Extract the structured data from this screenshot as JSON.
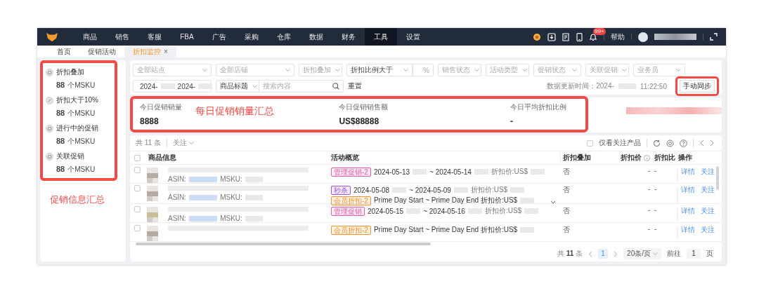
{
  "nav": {
    "items": [
      {
        "label": "商品",
        "selected": false
      },
      {
        "label": "销售",
        "selected": false
      },
      {
        "label": "客服",
        "selected": false
      },
      {
        "label": "FBA",
        "selected": false
      },
      {
        "label": "广告",
        "selected": false
      },
      {
        "label": "采购",
        "selected": false
      },
      {
        "label": "仓库",
        "selected": false
      },
      {
        "label": "数据",
        "selected": false
      },
      {
        "label": "财务",
        "selected": false
      },
      {
        "label": "工具",
        "selected": true
      },
      {
        "label": "设置",
        "selected": false
      }
    ],
    "badge": "99+",
    "help": "帮助"
  },
  "tabs": [
    {
      "label": "首页",
      "selected": false
    },
    {
      "label": "促销活动",
      "selected": false
    },
    {
      "label": "折扣监控",
      "selected": true,
      "close": "×"
    }
  ],
  "summary": [
    {
      "label": "折扣叠加",
      "count": "88",
      "unit": "个MSKU"
    },
    {
      "label": "折扣大于10%",
      "count": "88",
      "unit": "个MSKU"
    },
    {
      "label": "进行中的促销",
      "count": "88",
      "unit": "个MSKU"
    },
    {
      "label": "关联促销",
      "count": "88",
      "unit": "个MSKU"
    }
  ],
  "annotations": {
    "summary": "促销信息汇总",
    "stats": "每日促销销量汇总"
  },
  "filters": [
    {
      "kind": "select",
      "placeholder": "全部站点"
    },
    {
      "kind": "select",
      "placeholder": "全部店铺"
    },
    {
      "kind": "select",
      "placeholder": "折扣叠加"
    },
    {
      "kind": "select",
      "value": "折扣比例大于"
    },
    {
      "kind": "unit",
      "unit": "%"
    },
    {
      "kind": "select",
      "placeholder": "销售状态"
    },
    {
      "kind": "select",
      "placeholder": "活动类型"
    },
    {
      "kind": "select",
      "placeholder": "促销状态"
    },
    {
      "kind": "select",
      "placeholder": "关联促销"
    },
    {
      "kind": "select",
      "placeholder": "业务员"
    }
  ],
  "search": {
    "date_start": "2024-",
    "date_end": "2024-",
    "field": "商品标题",
    "placeholder": "搜索内容",
    "reset": "重置"
  },
  "update": {
    "label": "数据更新时间：2024-",
    "time": "11:22:50"
  },
  "sync_button": "手动同步",
  "stats": [
    {
      "label": "今日促销销量",
      "value": "8888"
    },
    {
      "label": "今日促销销售额",
      "value": "US$88888"
    },
    {
      "label": "今日平均折扣比例",
      "value": "-"
    }
  ],
  "toolbar": {
    "total": "共 11 条",
    "follow": "关注",
    "only_followed": {
      "label": "仅看关注产品",
      "checked": false
    }
  },
  "select_all_checked": false,
  "columns": [
    "商品信息",
    "活动概览",
    "折扣叠加",
    "折扣价",
    "折扣比",
    "操作"
  ],
  "rows": [
    {
      "checked": false,
      "asin_label": "ASIN:",
      "msku_label": "MSKU:",
      "activities": [
        {
          "tag": "管理促销-2",
          "color": "#e35aa6",
          "start": "2024-05-13",
          "end": "~ 2024-05-14",
          "price": "折扣价:US$"
        }
      ],
      "stacking": "否",
      "price": "-",
      "ratio": "-",
      "actions": [
        "详情",
        "关注"
      ]
    },
    {
      "checked": false,
      "asin_label": "ASIN:",
      "msku_label": "MSKU:",
      "activities": [
        {
          "tag": "秒杀",
          "color": "#9a5ad6",
          "start": "2024-05-08",
          "end": "~ 2024-05-09",
          "price": "折扣价:US$"
        },
        {
          "tag": "会员折扣-2",
          "color": "#f0932b",
          "start": "Prime Day Start ~ Prime Day End 折扣价:US$"
        }
      ],
      "expandable": true,
      "stacking": "否",
      "price": "-",
      "ratio": "-",
      "actions": [
        "详情",
        "关注"
      ]
    },
    {
      "checked": false,
      "asin_label": "ASIN:",
      "msku_label": "MSKU:",
      "activities": [
        {
          "tag": "管理促销",
          "color": "#e35aa6",
          "start": "2024-05-15",
          "end": "~ 2024-05-16",
          "price": "折扣价:US$"
        }
      ],
      "stacking": "否",
      "price": "-",
      "ratio": "-",
      "actions": [
        "详情",
        "关注"
      ]
    },
    {
      "checked": false,
      "activities": [
        {
          "tag": "会员折扣-2",
          "color": "#f0932b",
          "start": "Prime Day Start ~ Prime Day End 折扣价:US$"
        }
      ],
      "stacking": "否",
      "price": "-",
      "ratio": "-",
      "actions": [
        "详情",
        "关注"
      ]
    }
  ],
  "pagination": {
    "total_prefix": "共",
    "total": "11",
    "total_suffix": "条",
    "pages": [
      {
        "label": "1",
        "selected": true
      }
    ],
    "page_size": "20条/页",
    "goto": "前往",
    "goto_value": "1",
    "goto_suffix": "页"
  }
}
